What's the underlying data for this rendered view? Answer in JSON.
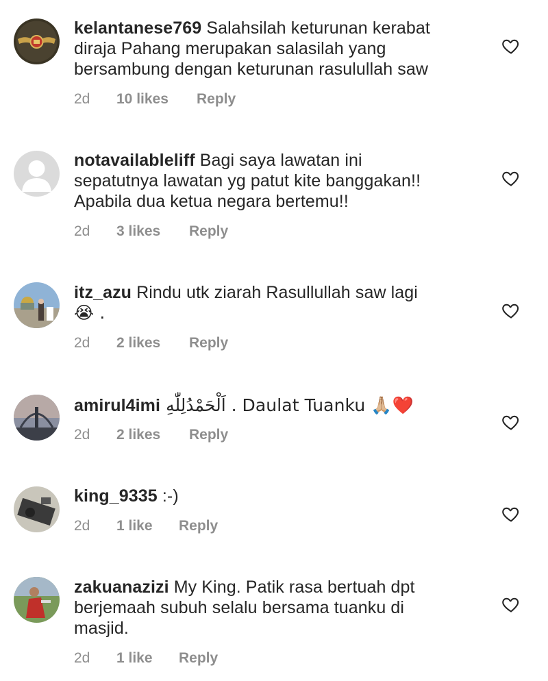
{
  "comments": [
    {
      "username": "kelantanese769",
      "text_lines": [
        "Salahsilah keturunan kerabat",
        "diraja Pahang merupakan salasilah yang",
        "bersambung dengan keturunan rasulullah saw"
      ],
      "time": "2d",
      "likes": "10 likes",
      "reply": "Reply",
      "avatar_icon": "royal-crest-avatar"
    },
    {
      "username": "notavailableliff",
      "text_lines": [
        "Bagi saya lawatan ini",
        "sepatutnya lawatan yg patut kite banggakan!!",
        "Apabila dua ketua negara bertemu!!"
      ],
      "time": "2d",
      "likes": "3 likes",
      "reply": "Reply",
      "avatar_icon": "default-user-avatar"
    },
    {
      "username": "itz_azu",
      "text_lines": [
        "Rindu utk ziarah Rasullullah saw lagi",
        "😭 ."
      ],
      "time": "2d",
      "likes": "2 likes",
      "reply": "Reply",
      "avatar_icon": "photo-avatar"
    },
    {
      "username": "amirul4imi",
      "text_lines": [
        "اَلْحَمْدُلِلّٰهِ . Daulat Tuanku 🙏🏼❤️"
      ],
      "time": "2d",
      "likes": "2 likes",
      "reply": "Reply",
      "avatar_icon": "photo-avatar"
    },
    {
      "username": "king_9335",
      "text_lines": [
        ":-)"
      ],
      "time": "2d",
      "likes": "1 like",
      "reply": "Reply",
      "avatar_icon": "photo-avatar"
    },
    {
      "username": "zakuanazizi",
      "text_lines": [
        "My King. Patik rasa bertuah dpt",
        "berjemaah subuh selalu bersama tuanku di",
        "masjid."
      ],
      "time": "2d",
      "likes": "1 like",
      "reply": "Reply",
      "avatar_icon": "photo-avatar"
    }
  ],
  "colors": {
    "text": "#262626",
    "meta": "#8e8e8e",
    "heart": "#262626"
  }
}
